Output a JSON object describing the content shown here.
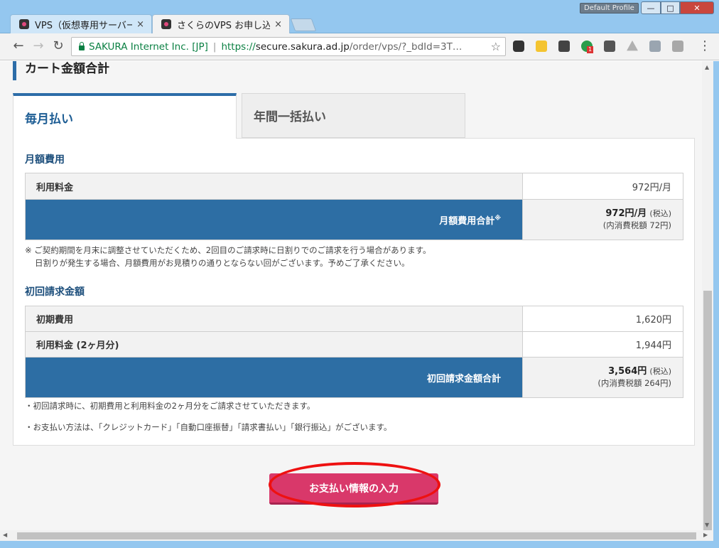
{
  "browser": {
    "tabs": [
      {
        "title": "VPS（仮想専用サーバー",
        "close": "×"
      },
      {
        "title": "さくらのVPS お申し込み",
        "close": "×"
      }
    ],
    "profile_label": "Default Profile",
    "window_controls": {
      "min": "—",
      "max": "□",
      "close": "✕"
    },
    "nav": {
      "back": "←",
      "forward": "→",
      "reload": "↻"
    },
    "ev_label": "SAKURA Internet Inc. [JP]",
    "separator": "|",
    "url": {
      "scheme": "https://",
      "host": "secure.sakura.ad.jp",
      "path": "/order/vps/?_bdId=3T…"
    },
    "star": "☆",
    "menu": "⋮",
    "extension_badge": "1"
  },
  "page": {
    "section_title": "カート金額合計",
    "tabs": {
      "monthly": "毎月払い",
      "yearly": "年間一括払い"
    },
    "monthly": {
      "heading": "月額費用",
      "rows": [
        {
          "label": "利用料金",
          "value": "972円/月"
        }
      ],
      "total": {
        "label": "月額費用合計",
        "mark": "※",
        "value": "972円/月",
        "tax_note": "(税込)",
        "sub": "(内消費税額 72円)"
      },
      "note_line1": "※ ご契約期間を月末に調整させていただくため、2回目のご請求時に日割りでのご請求を行う場合があります。",
      "note_line2": "日割りが発生する場合、月額費用がお見積りの通りとならない回がございます。予めご了承ください。"
    },
    "initial": {
      "heading": "初回請求金額",
      "rows": [
        {
          "label": "初期費用",
          "value": "1,620円"
        },
        {
          "label": "利用料金 (2ヶ月分)",
          "value": "1,944円"
        }
      ],
      "total": {
        "label": "初回請求金額合計",
        "value": "3,564円",
        "tax_note": "(税込)",
        "sub": "(内消費税額 264円)"
      },
      "note1": "・初回請求時に、初期費用と利用料金の2ヶ月分をご請求させていただきます。",
      "note2": "・お支払い方法は、「クレジットカード」「自動口座振替」「請求書払い」「銀行振込」がございます。"
    },
    "submit_label": "お支払い情報の入力"
  },
  "colors": {
    "accent": "#2d6ea4",
    "button": "#d9386a",
    "highlight": "#ee1111",
    "ev_green": "#0b8043"
  }
}
